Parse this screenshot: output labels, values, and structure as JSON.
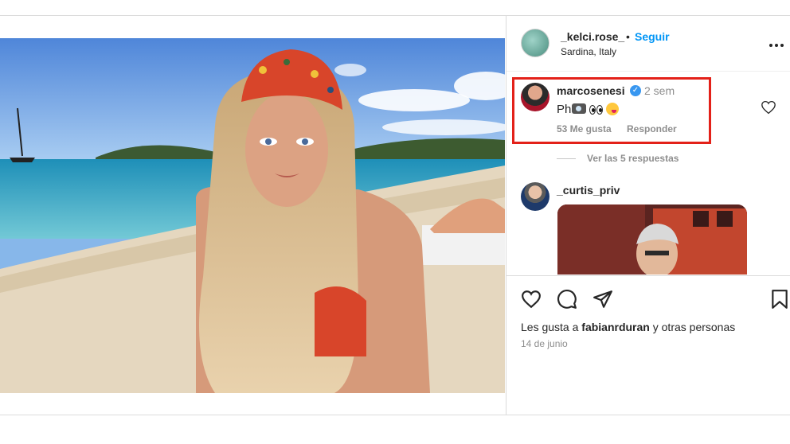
{
  "post": {
    "author": "_kelci.rose_",
    "separator": "•",
    "follow_label": "Seguir",
    "location": "Sardina, Italy"
  },
  "comments": [
    {
      "user": "marcosenesi",
      "verified": true,
      "time": "2 sem",
      "text_prefix": "Ph",
      "emojis": [
        "camera-emoji",
        "eyes-emoji",
        "face-emoji"
      ],
      "likes": "53 Me gusta",
      "reply_label": "Responder"
    },
    {
      "user": "_curtis_priv"
    }
  ],
  "view_replies": "Ver las 5 respuestas",
  "footer": {
    "likes_prefix": "Les gusta a ",
    "likes_user": "fabianrduran",
    "likes_suffix": " y otras personas",
    "date": "14 de junio"
  },
  "icons": [
    "more-icon",
    "heart-icon",
    "comment-icon",
    "share-icon",
    "bookmark-icon",
    "verified-icon"
  ],
  "colors": {
    "follow": "#0095f6",
    "highlight": "#e32119",
    "verified": "#3897f0",
    "muted": "#8e8e8e"
  }
}
